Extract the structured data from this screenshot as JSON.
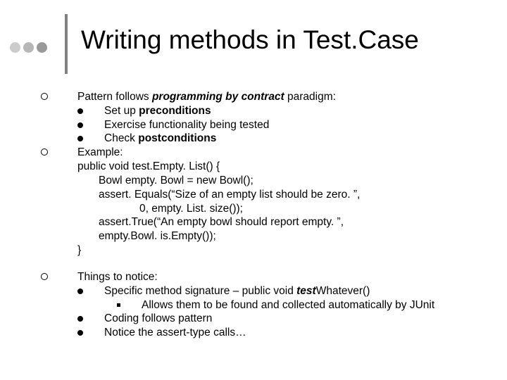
{
  "title": "Writing methods in Test.Case",
  "section1": {
    "intro_a": "Pattern follows ",
    "intro_b": "programming by contract",
    "intro_c": " paradigm:",
    "sub1_a": "Set up ",
    "sub1_b": "preconditions",
    "sub2": "Exercise functionality being tested",
    "sub3_a": "Check ",
    "sub3_b": "postconditions"
  },
  "section2": {
    "label": "Example:",
    "code1": "public void test.Empty. List() {",
    "code2": "Bowl empty. Bowl = new Bowl();",
    "code3": "assert. Equals(“Size of an empty list should be zero. ”,",
    "code4": "0, empty. List. size());",
    "code5": "assert.True(“An empty bowl should report empty. ”,",
    "code6": "empty.Bowl. is.Empty());",
    "code7": "}"
  },
  "section3": {
    "intro": "Things to notice:",
    "sub1_a": "Specific method signature – public void ",
    "sub1_b": "test",
    "sub1_c": "Whatever()",
    "sub1_sub": "Allows them to be found and collected automatically by JUnit",
    "sub2": "Coding follows pattern",
    "sub3": "Notice the assert-type calls…"
  }
}
